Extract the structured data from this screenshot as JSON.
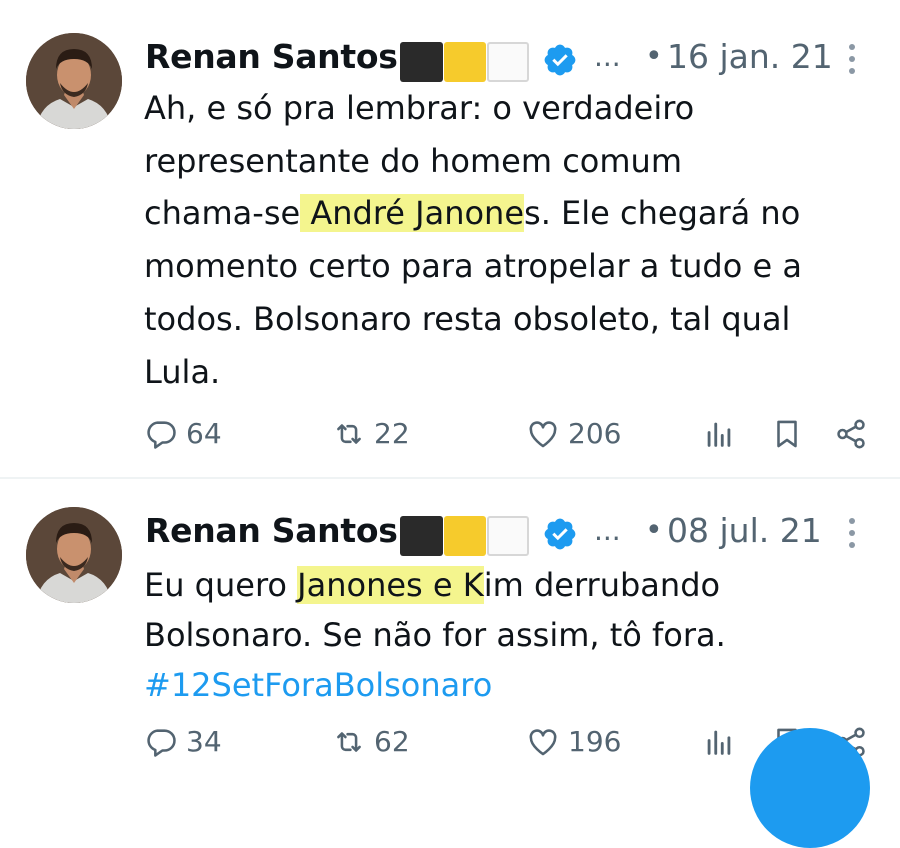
{
  "tweets": [
    {
      "author": "Renan Santos",
      "ellipsis": "...",
      "separator": "•",
      "date": "16 jan. 21",
      "lines": [
        [
          {
            "t": "Ah, e só pra lembrar: o verdadeiro"
          }
        ],
        [
          {
            "t": "representante do homem comum"
          }
        ],
        [
          {
            "t": "chama-se"
          },
          {
            "t": " André Janone",
            "hl": true
          },
          {
            "t": "s. Ele chegará no"
          }
        ],
        [
          {
            "t": "momento certo para atropelar a tudo e a"
          }
        ],
        [
          {
            "t": "todos. Bolsonaro resta obsoleto, tal qual"
          }
        ],
        [
          {
            "t": "Lula."
          }
        ]
      ],
      "replies": "64",
      "retweets": "22",
      "likes": "206"
    },
    {
      "author": "Renan Santos",
      "ellipsis": "...",
      "separator": "•",
      "date": "08 jul. 21",
      "lines": [
        [
          {
            "t": "Eu quero "
          },
          {
            "t": "Janones e K",
            "hl": true
          },
          {
            "t": "im derrubando"
          }
        ],
        [
          {
            "t": "Bolsonaro. Se não for assim, tô fora."
          }
        ],
        [
          {
            "t": "#12SetForaBolsonaro",
            "link": true
          }
        ]
      ],
      "replies": "34",
      "retweets": "62",
      "likes": "196"
    }
  ],
  "colors": {
    "text": "#0f1419",
    "secondary": "#536471",
    "link": "#1d9bf0",
    "highlight": "#f4f58e",
    "verified": "#1d9bf0"
  },
  "icons": {
    "verified": "verified-badge-icon",
    "more": "more-vertical-icon",
    "reply": "reply-icon",
    "retweet": "retweet-icon",
    "like": "heart-icon",
    "views": "views-icon",
    "bookmark": "bookmark-icon",
    "share": "share-icon",
    "flag_emojis": [
      "black-square-icon",
      "yellow-square-icon",
      "white-square-icon"
    ]
  }
}
